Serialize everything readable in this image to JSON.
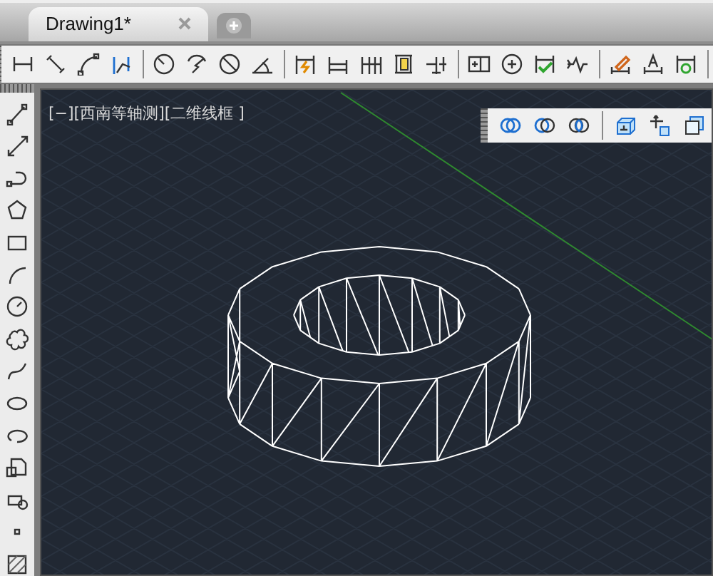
{
  "tabs": [
    {
      "label": "Drawing1*",
      "selected": true
    }
  ],
  "viewport": {
    "label": "[−][西南等轴测][二维线框 ]"
  }
}
